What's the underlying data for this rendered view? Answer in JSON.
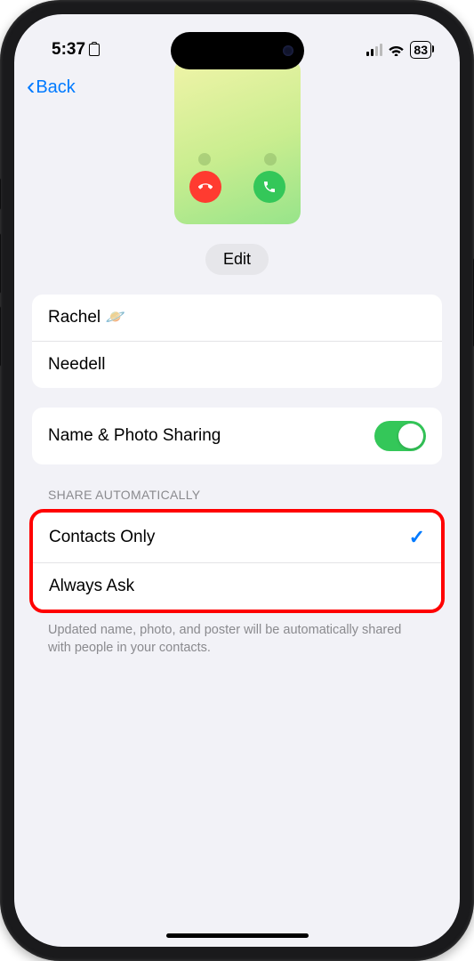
{
  "status": {
    "time": "5:37",
    "battery": "83"
  },
  "nav": {
    "back_label": "Back"
  },
  "edit_label": "Edit",
  "name": {
    "first": "Rachel",
    "emoji": "🪐",
    "last": "Needell"
  },
  "sharing": {
    "label": "Name & Photo Sharing",
    "enabled": true
  },
  "share_section": {
    "header": "SHARE AUTOMATICALLY",
    "options": [
      {
        "label": "Contacts Only",
        "selected": true
      },
      {
        "label": "Always Ask",
        "selected": false
      }
    ],
    "footer": "Updated name, photo, and poster will be automatically shared with people in your contacts."
  }
}
